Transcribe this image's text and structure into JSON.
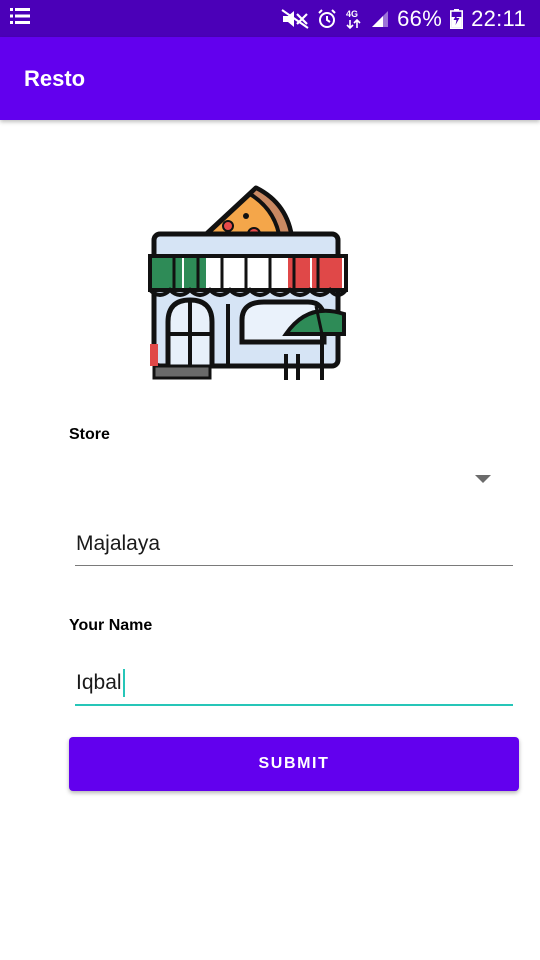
{
  "status_bar": {
    "battery_text": "66%",
    "time": "22:11",
    "network_label": "4G",
    "icons": [
      "menu-list-icon",
      "mute-icon",
      "alarm-icon",
      "network-4g-icon",
      "signal-icon",
      "battery-charging-icon"
    ]
  },
  "app_bar": {
    "title": "Resto",
    "color": "#6200ee"
  },
  "illustration": {
    "icon": "pizza-store-icon"
  },
  "form": {
    "store_label": "Store",
    "store_spinner_value": "",
    "store_text_value": "Majalaya",
    "name_label": "Your Name",
    "name_value": "Iqbal",
    "submit_label": "SUBMIT"
  },
  "colors": {
    "status_bar": "#4b00b8",
    "primary": "#6200ee",
    "accent": "#26c6b8"
  }
}
